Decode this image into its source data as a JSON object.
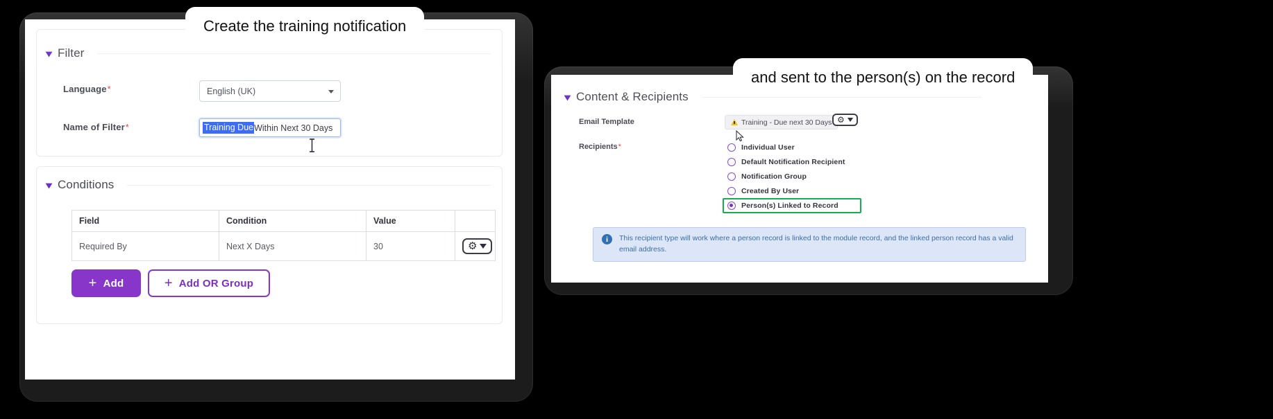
{
  "callouts": {
    "left": "Create the training notification",
    "right": "and sent to the person(s) on the record"
  },
  "left_screen": {
    "filter_section": {
      "title": "Filter",
      "chevron": "chevron-down-icon",
      "language": {
        "label": "Language",
        "required_marker": "*",
        "value": "English (UK)"
      },
      "filter_name": {
        "label": "Name of Filter",
        "required_marker": "*",
        "selected_text": "Training Due",
        "rest_text": " Within Next 30 Days",
        "full_value": "Training Due Within Next 30 Days"
      }
    },
    "conditions_section": {
      "title": "Conditions",
      "chevron": "chevron-down-icon",
      "table": {
        "headers": [
          "Field",
          "Condition",
          "Value",
          ""
        ],
        "rows": [
          {
            "field": "Required By",
            "condition": "Next X Days",
            "value": "30",
            "action_icon": "gear-icon",
            "action_caret": "chevron-down-icon"
          }
        ]
      },
      "buttons": {
        "add": {
          "plus": "+",
          "label": "Add"
        },
        "add_or_group": {
          "plus": "+",
          "label": "Add OR Group"
        }
      }
    }
  },
  "right_screen": {
    "section": {
      "title": "Content & Recipients",
      "chevron": "chevron-down-icon"
    },
    "email_template": {
      "label": "Email Template",
      "warning_icon": "warning-triangle-icon",
      "value": "Training - Due next 30 Days",
      "action_icon": "gear-icon",
      "action_caret": "chevron-down-icon"
    },
    "recipients": {
      "label": "Recipients",
      "required_marker": "*",
      "options": [
        {
          "label": "Individual User",
          "selected": false,
          "highlighted": false
        },
        {
          "label": "Default Notification Recipient",
          "selected": false,
          "highlighted": false
        },
        {
          "label": "Notification Group",
          "selected": false,
          "highlighted": false
        },
        {
          "label": "Created By User",
          "selected": false,
          "highlighted": false
        },
        {
          "label": "Person(s) Linked to Record",
          "selected": true,
          "highlighted": true
        }
      ]
    },
    "info_banner": {
      "icon": "info-icon",
      "text": "This recipient type will work where a person record is linked to the module record, and the linked person record has a valid email address."
    }
  },
  "colors": {
    "accent_purple": "#8836c9",
    "highlight_green": "#12b04a",
    "selection_blue": "#3b6ef5",
    "info_blue": "#3b6ea8",
    "required_red": "#e8453c"
  }
}
